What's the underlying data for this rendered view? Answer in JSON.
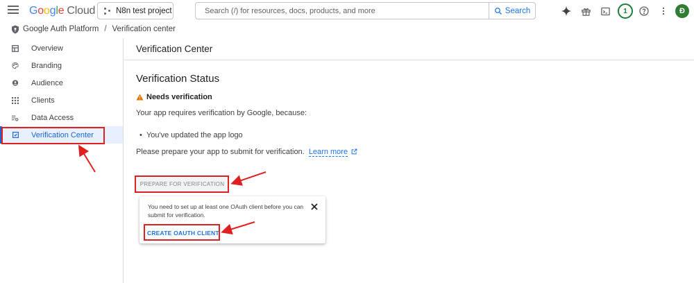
{
  "topbar": {
    "logo_google": "Google",
    "logo_cloud": "Cloud",
    "project_name": "N8n test project",
    "search_placeholder": "Search (/) for resources, docs, products, and more",
    "search_button": "Search",
    "notification_count": "1",
    "avatar_initial": "Đ"
  },
  "breadcrumb": {
    "root": "Google Auth Platform",
    "separator": "/",
    "current": "Verification center"
  },
  "sidebar": {
    "items": [
      {
        "label": "Overview",
        "icon": "dashboard-icon"
      },
      {
        "label": "Branding",
        "icon": "palette-icon"
      },
      {
        "label": "Audience",
        "icon": "person-icon"
      },
      {
        "label": "Clients",
        "icon": "grid-icon"
      },
      {
        "label": "Data Access",
        "icon": "data-access-icon"
      },
      {
        "label": "Verification Center",
        "icon": "verification-icon",
        "active": true
      }
    ]
  },
  "header": {
    "title": "Verification Center"
  },
  "main": {
    "status_title": "Verification Status",
    "warning_label": "Needs verification",
    "requirement_text": "Your app requires verification by Google, because:",
    "reasons": [
      "You've updated the app logo"
    ],
    "prepare_text": "Please prepare your app to submit for verification.",
    "learn_more": "Learn more",
    "prepare_button": "PREPARE FOR VERIFICATION"
  },
  "tooltip": {
    "text": "You need to set up at least one OAuth client before you can submit for verification.",
    "action": "CREATE OAUTH CLIENT"
  },
  "colors": {
    "accent": "#1a73e8",
    "warning": "#e37400",
    "annotation_red": "#e02020",
    "active_nav_bg": "#e8f0fe"
  }
}
